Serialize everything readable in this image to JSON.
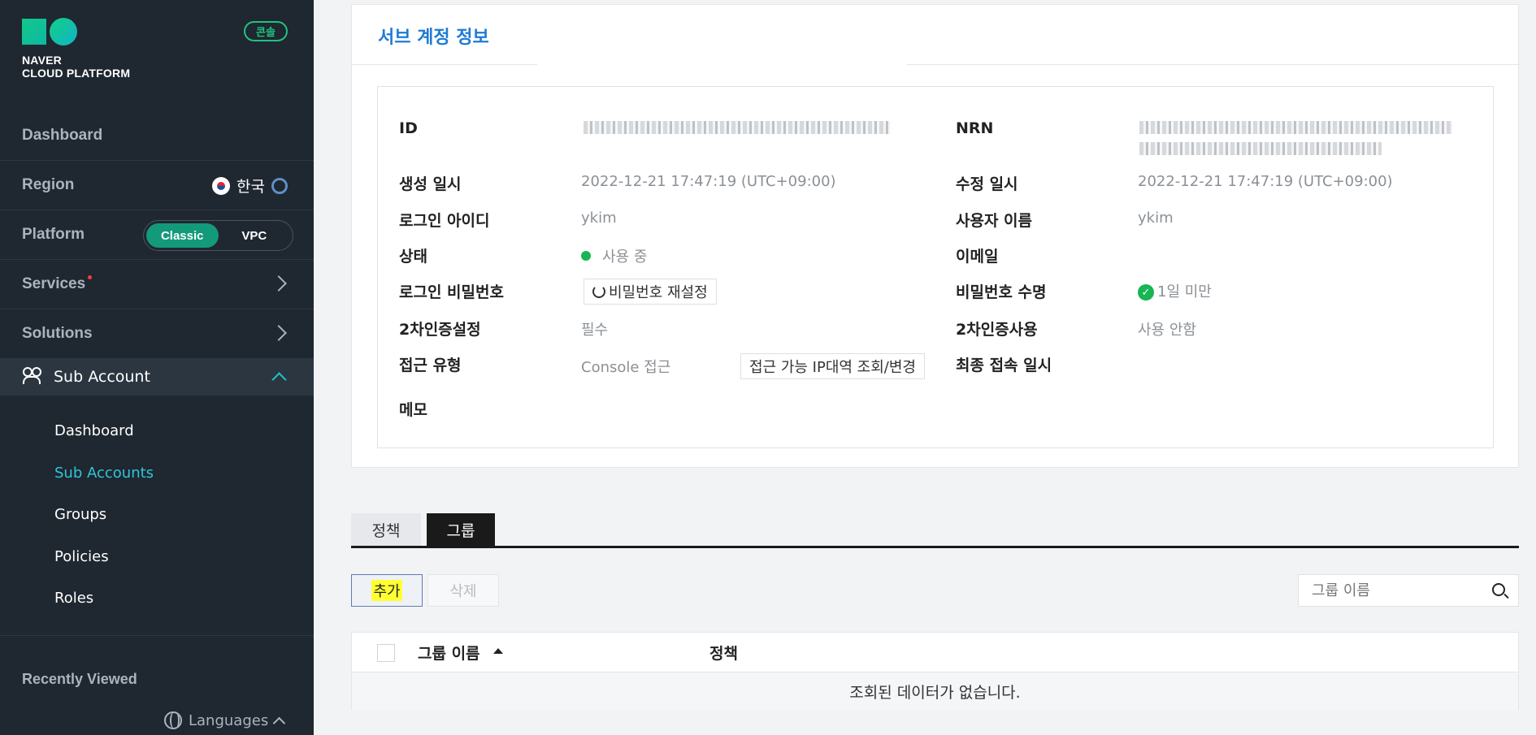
{
  "sidebar": {
    "logo_line1": "NAVER",
    "logo_line2": "CLOUD PLATFORM",
    "console_badge": "콘솔",
    "nav": {
      "dashboard": "Dashboard",
      "region": "Region",
      "region_value": "한국",
      "platform": "Platform",
      "platform_classic": "Classic",
      "platform_vpc": "VPC",
      "services": "Services",
      "solutions": "Solutions",
      "sub_account": "Sub Account"
    },
    "sub_items": [
      "Dashboard",
      "Sub Accounts",
      "Groups",
      "Policies",
      "Roles"
    ],
    "active_sub_item": "Sub Accounts",
    "recently_viewed": "Recently Viewed",
    "languages": "Languages"
  },
  "card": {
    "title": "서브 계정 정보",
    "left": {
      "id_label": "ID",
      "created_label": "생성 일시",
      "created_value": "2022-12-21 17:47:19 (UTC+09:00)",
      "login_id_label": "로그인 아이디",
      "login_id_value": "ykim",
      "status_label": "상태",
      "status_value": "사용 중",
      "password_label": "로그인 비밀번호",
      "password_reset_button": "비밀번호 재설정",
      "twofa_setting_label": "2차인증설정",
      "twofa_setting_value": "필수",
      "access_type_label": "접근 유형",
      "access_type_value": "Console 접근",
      "ip_range_button": "접근 가능 IP대역 조회/변경",
      "memo_label": "메모"
    },
    "right": {
      "nrn_label": "NRN",
      "modified_label": "수정 일시",
      "modified_value": "2022-12-21 17:47:19 (UTC+09:00)",
      "username_label": "사용자 이름",
      "username_value": "ykim",
      "email_label": "이메일",
      "pw_lifetime_label": "비밀번호 수명",
      "pw_lifetime_value": "1일 미만",
      "twofa_use_label": "2차인증사용",
      "twofa_use_value": "사용 안함",
      "last_access_label": "최종 접속 일시"
    }
  },
  "tabs": [
    "정책",
    "그룹"
  ],
  "active_tab": "그룹",
  "toolbar": {
    "add_label": "추가",
    "delete_label": "삭제",
    "search_placeholder": "그룹 이름"
  },
  "table": {
    "columns": [
      "그룹 이름",
      "정책"
    ],
    "empty_message": "조회된 데이터가 없습니다."
  },
  "colors": {
    "sidebar_bg": "#1f2730",
    "accent_green": "#139a7a",
    "title_blue": "#1e7bd6",
    "active_cyan": "#2ec7d8",
    "highlight_yellow": "#ffff33"
  }
}
